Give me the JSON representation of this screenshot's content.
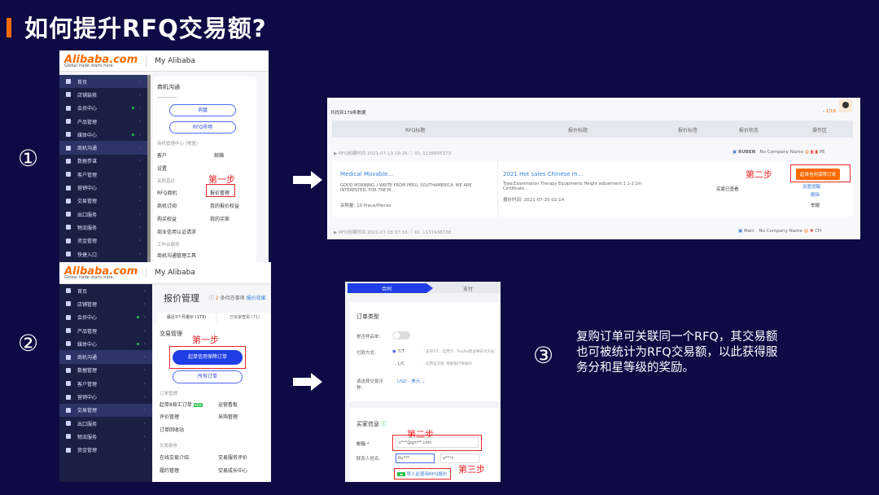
{
  "title": "如何提升RFQ交易额?",
  "step_markers": [
    "①",
    "②",
    "③"
  ],
  "colors": {
    "background": "#0d0a44",
    "accent": "#ff6a00",
    "highlight_red": "#e8262a",
    "primary_blue": "#1f3ee6"
  },
  "panel1": {
    "logo": "Alibaba.com",
    "logo_tagline": "Global trade starts here.",
    "header": "My Alibaba",
    "sidebar": [
      {
        "label": "首页",
        "active": true
      },
      {
        "label": "店铺装修"
      },
      {
        "label": "会员中心",
        "dot": true
      },
      {
        "label": "产品管理"
      },
      {
        "label": "媒体中心",
        "dot": true
      },
      {
        "label": "商机沟通",
        "active": true
      },
      {
        "label": "数据参谋"
      },
      {
        "label": "客户管理"
      },
      {
        "label": "营销中心"
      },
      {
        "label": "交易管理"
      },
      {
        "label": "出口服务"
      },
      {
        "label": "物流服务"
      },
      {
        "label": "资金管理"
      },
      {
        "label": "快捷入口"
      }
    ],
    "menu": {
      "title": "商机沟通",
      "buttons": [
        "询盘",
        "RFQ市场"
      ],
      "section1": "商机管理中心 (预置)",
      "links1": [
        "客户",
        "邮箱",
        "设置"
      ],
      "section2": "采购直达",
      "links2": [
        "RFQ商机",
        "报价管理",
        "商机订阅",
        "我的报价权益",
        "购买权益",
        "我的买家",
        "商业信用认证请求"
      ],
      "section3": "工作台服务",
      "links3": [
        "商机沟通管理工具"
      ]
    },
    "annotation": "第一步"
  },
  "panel2": {
    "toolbar_count": "共找到179条数据",
    "pagination": "1/18",
    "columns": [
      "RFQ标题",
      "报价标题",
      "报价标签",
      "报价状态",
      "操作区"
    ],
    "rows": [
      {
        "meta_label": "RFQ创建时间",
        "meta_time": "2021-07-13 19:26",
        "id": "ID: 1138895373",
        "buyer": "RUBEN",
        "company": "No Company Name",
        "country": "PE",
        "rfq_title": "Medical Movable...",
        "rfq_desc": "GOOD MORNING. I WRITE FROM PERU, SOUTHAMERICA. WE ARE INTERESTED, FOR THE M...",
        "rfq_qty": "采购量: 10 Piece/Pieces",
        "quote_title": "2021 Hot sales Chinese m...",
        "quote_desc": "Type:Examination Therapy Equipments Height adjustment:1.1-2.1m Certificate...",
        "quote_time": "报价时间: 2021-07-20 02:14",
        "status": "买家已查看",
        "actions": [
          "起单信用保障订单",
          "设置提醒",
          "删除",
          "举报"
        ]
      },
      {
        "meta_label": "RFQ创建时间",
        "meta_time": "2021-07-18 07:33",
        "id": "ID: 1137438738",
        "buyer": "Marc",
        "company": "No Company Name",
        "country": "CH"
      }
    ],
    "annotation": "第二步"
  },
  "panel3": {
    "logo": "Alibaba.com",
    "logo_tagline": "Global trade starts here.",
    "header": "My Alibaba",
    "page_title": "报价管理",
    "pending": "2",
    "pending_label": "条待办事项",
    "link": "报价效果",
    "tabs": [
      "最近3个月报价 (179)",
      "已买家查看 (71)"
    ],
    "sidebar": [
      {
        "label": "首页"
      },
      {
        "label": "店铺管理"
      },
      {
        "label": "会员中心",
        "dot": true
      },
      {
        "label": "产品管理"
      },
      {
        "label": "媒体中心",
        "dot": true
      },
      {
        "label": "商机沟通",
        "active": true
      },
      {
        "label": "数据管理"
      },
      {
        "label": "客户管理"
      },
      {
        "label": "营销中心"
      },
      {
        "label": "交易管理",
        "active": true
      },
      {
        "label": "出口服务"
      },
      {
        "label": "物流服务"
      },
      {
        "label": "资金管理"
      }
    ],
    "menu": {
      "title": "交易管理",
      "primary_button": "起单信用保障订单",
      "secondary_button": "所有订单",
      "section1": "订单管理",
      "links1": [
        "起单8按汇订单",
        "运营看板",
        "评价管理",
        "采购管理",
        "订单回收站"
      ],
      "new_badge": "NEW",
      "section2": "交易服务",
      "links2": [
        "在线交易介绍",
        "交易服务评价",
        "履约管理",
        "交易成长中心"
      ]
    },
    "annotation": "第一步"
  },
  "panel4": {
    "steps": [
      "合同",
      "支付"
    ],
    "order_type": "订单类型",
    "sample_label": "是否样品单:",
    "pay_label": "付款方式:",
    "pay_options": [
      {
        "label": "T/T",
        "desc": "- 支持T/T、信用卡、PayPal等多种支付方式",
        "selected": true
      },
      {
        "label": "L/C",
        "desc": "- 信用证交易, 需要银行审核的",
        "selected": false
      }
    ],
    "currency_label": "请选择交易币种:",
    "currency_value": "USD - 美元",
    "buyer_info": "买家信息",
    "email_label": "邮箱 *",
    "email_value": "s***@gm**.com",
    "contact_label": "联系人姓名:",
    "first_name": "Ru***",
    "last_name": "a***s",
    "import_rfq": "导入此使用RFQ报价",
    "annotation2": "第二步",
    "annotation3": "第三步"
  },
  "note": "复购订单可关联同一个RFQ，其交易额也可被统计为RFQ交易额，以此获得服务分和星等级的奖励。"
}
